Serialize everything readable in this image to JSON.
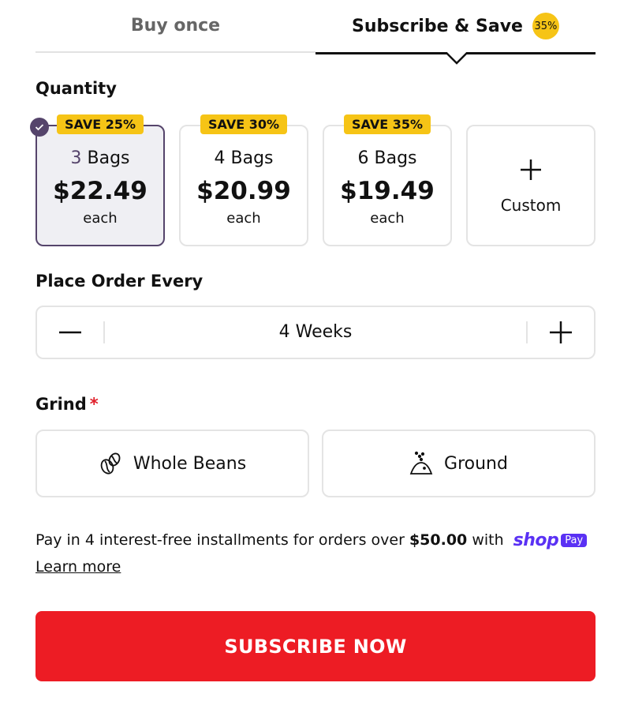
{
  "tabs": {
    "buy_once": "Buy once",
    "subscribe": "Subscribe & Save",
    "subscribe_badge": "35%"
  },
  "quantity": {
    "label": "Quantity",
    "options": [
      {
        "save": "SAVE 25%",
        "count": "3",
        "unit": " Bags",
        "price": "$22.49",
        "each": "each",
        "selected": true
      },
      {
        "save": "SAVE 30%",
        "count": "4",
        "unit": " Bags",
        "price": "$20.99",
        "each": "each",
        "selected": false
      },
      {
        "save": "SAVE 35%",
        "count": "6",
        "unit": " Bags",
        "price": "$19.49",
        "each": "each",
        "selected": false
      }
    ],
    "custom_label": "Custom"
  },
  "frequency": {
    "label": "Place Order Every",
    "value": "4 Weeks"
  },
  "grind": {
    "label": "Grind",
    "required_mark": "*",
    "options": [
      {
        "label": "Whole Beans",
        "icon": "coffee-beans-icon"
      },
      {
        "label": "Ground",
        "icon": "ground-coffee-icon"
      }
    ]
  },
  "payment": {
    "text_before": "Pay in 4 interest-free installments for orders over ",
    "amount": "$50.00",
    "text_after": " with ",
    "shop_word": "shop",
    "shop_pay": "Pay",
    "learn_more": "Learn more"
  },
  "cta": {
    "label": "SUBSCRIBE NOW"
  },
  "colors": {
    "accent": "#55446b",
    "badge": "#f6c416",
    "cta": "#ed1c24",
    "shop": "#5a31f4"
  }
}
